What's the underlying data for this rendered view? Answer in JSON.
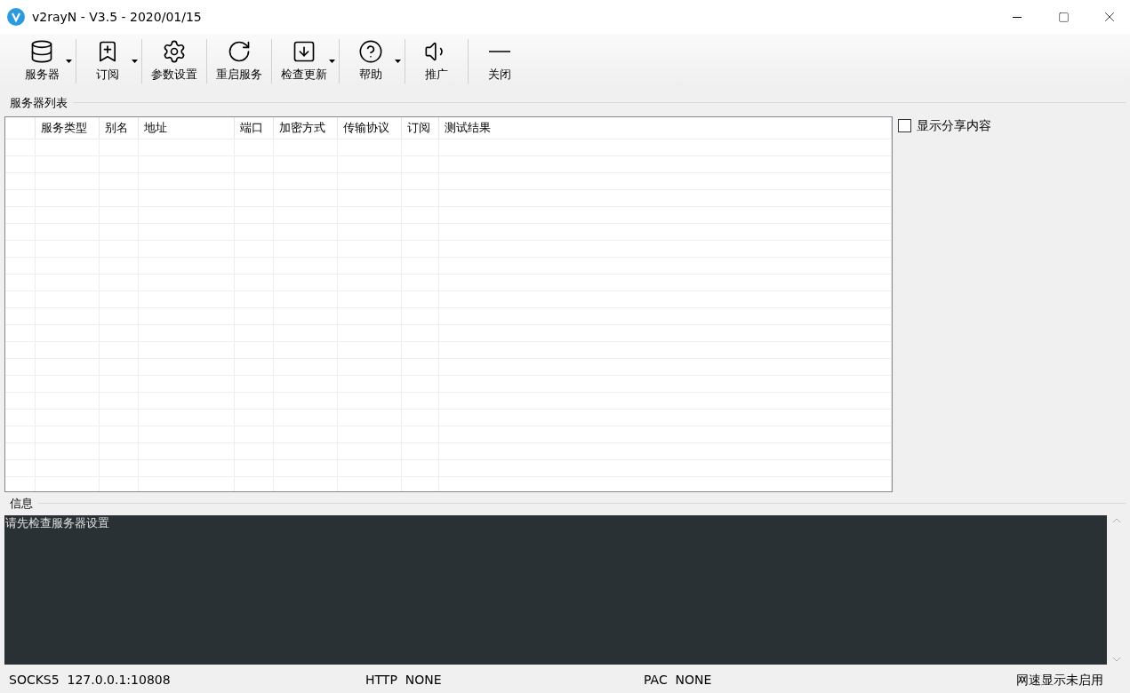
{
  "window": {
    "title": "v2rayN - V3.5 - 2020/01/15"
  },
  "toolbar": [
    {
      "label": "服务器",
      "dropdown": true
    },
    {
      "label": "订阅",
      "dropdown": true
    },
    {
      "label": "参数设置",
      "dropdown": false
    },
    {
      "label": "重启服务",
      "dropdown": false
    },
    {
      "label": "检查更新",
      "dropdown": true
    },
    {
      "label": "帮助",
      "dropdown": true
    },
    {
      "label": "推广",
      "dropdown": false
    },
    {
      "label": "关闭",
      "dropdown": false
    }
  ],
  "server_list": {
    "title": "服务器列表",
    "columns": [
      "服务类型",
      "别名",
      "地址",
      "端口",
      "加密方式",
      "传输协议",
      "订阅",
      "测试结果"
    ]
  },
  "show_share": {
    "label": "显示分享内容",
    "checked": false
  },
  "info": {
    "title": "信息",
    "log": "请先检查服务器设置"
  },
  "status_bar": [
    "SOCKS5  127.0.0.1:10808",
    "HTTP  NONE",
    "PAC  NONE",
    "网速显示未启用"
  ]
}
